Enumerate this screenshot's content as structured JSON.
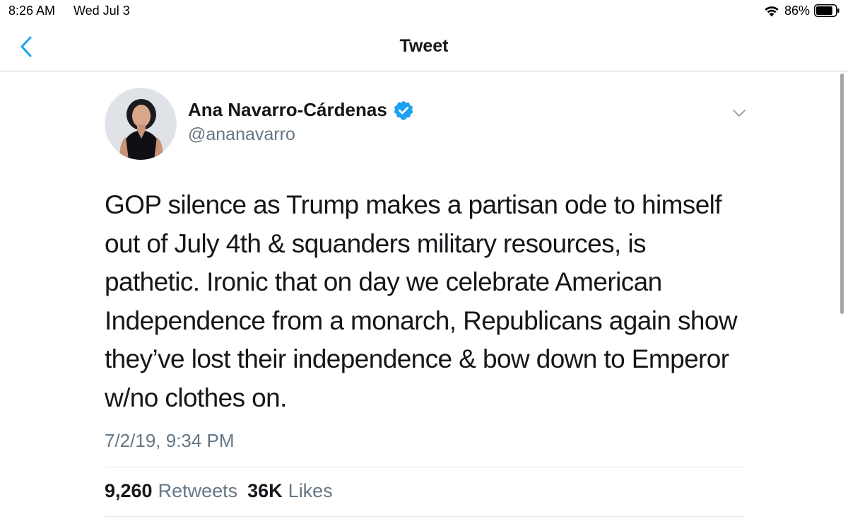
{
  "status_bar": {
    "time": "8:26 AM",
    "date": "Wed Jul 3",
    "battery_percent": "86%",
    "battery_level": 0.86,
    "wifi_icon": "wifi-icon",
    "battery_icon": "battery-icon"
  },
  "nav": {
    "title": "Tweet",
    "back_icon": "chevron-left-icon"
  },
  "tweet": {
    "author_name": "Ana Navarro-Cárdenas",
    "verified": true,
    "handle": "@ananavarro",
    "text": "GOP silence as Trump makes a partisan ode to himself\nout of July 4th & squanders military resources, is\npathetic. Ironic that on day we celebrate American\nIndependence from a monarch, Republicans again show\nthey’ve lost their independence & bow down to Emperor\nw/no clothes on.",
    "timestamp": "7/2/19, 9:34 PM",
    "retweets_count": "9,260",
    "retweets_label": "Retweets",
    "likes_count": "36K",
    "likes_label": "Likes"
  },
  "colors": {
    "accent": "#1da1f2",
    "text_primary": "#14171a",
    "text_secondary": "#657786",
    "divider": "#e1e8ed"
  }
}
